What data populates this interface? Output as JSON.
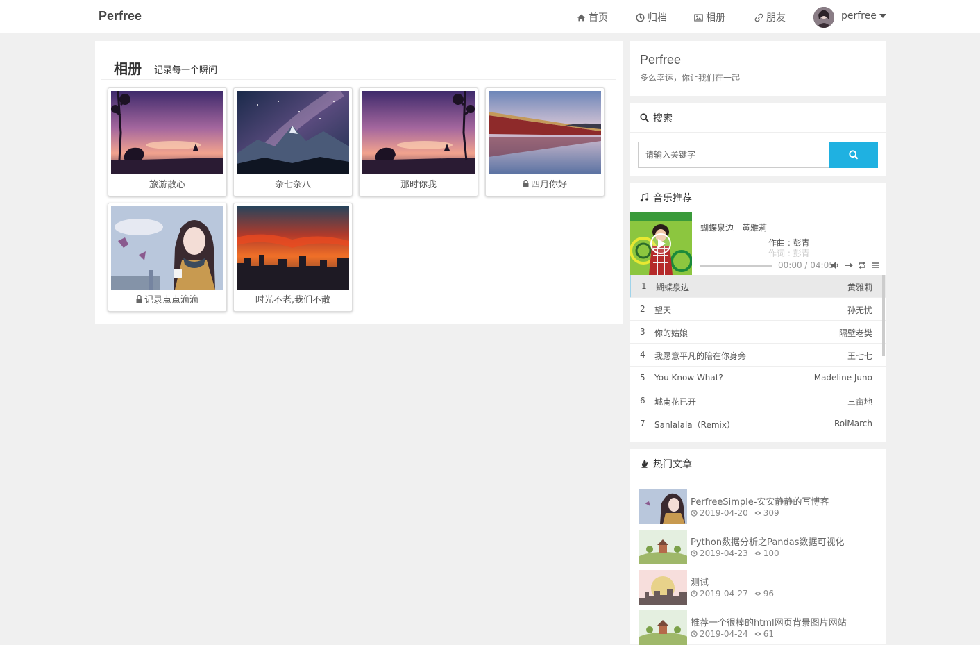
{
  "nav": {
    "brand": "Perfree",
    "items": [
      {
        "label": "首页",
        "icon": "home-icon"
      },
      {
        "label": "归档",
        "icon": "clock-icon"
      },
      {
        "label": "相册",
        "icon": "image-icon"
      },
      {
        "label": "朋友",
        "icon": "link-icon"
      }
    ],
    "user": "perfree"
  },
  "album": {
    "title": "相册",
    "subtitle": "记录每一个瞬间",
    "cards": [
      {
        "label": "旅游散心",
        "locked": false
      },
      {
        "label": "杂七杂八",
        "locked": false
      },
      {
        "label": "那时你我",
        "locked": false
      },
      {
        "label": "四月你好",
        "locked": true
      },
      {
        "label": "记录点点滴滴",
        "locked": true
      },
      {
        "label": "时光不老,我们不散",
        "locked": false
      }
    ]
  },
  "sidebar": {
    "site": {
      "title": "Perfree",
      "subtitle": "多么幸运，你让我们在一起"
    },
    "search": {
      "heading": "搜索",
      "placeholder": "请输入关键字"
    },
    "music": {
      "heading": "音乐推荐",
      "now_playing": "蝴蝶泉边 - 黄雅莉",
      "lyric_line1": "作曲 : 彭青",
      "lyric_line2": "作词 : 彭青",
      "time": "00:00 / 04:05",
      "progress": 0,
      "playlist": [
        {
          "n": "1",
          "title": "蝴蝶泉边",
          "artist": "黄雅莉"
        },
        {
          "n": "2",
          "title": "望天",
          "artist": "孙无忧"
        },
        {
          "n": "3",
          "title": "你的姑娘",
          "artist": "隔壁老樊"
        },
        {
          "n": "4",
          "title": "我愿意平凡的陪在你身旁",
          "artist": "王七七"
        },
        {
          "n": "5",
          "title": "You Know What?",
          "artist": "Madeline Juno"
        },
        {
          "n": "6",
          "title": "城南花已开",
          "artist": "三亩地"
        },
        {
          "n": "7",
          "title": "Sanlalala（Remix）",
          "artist": "RoiMarch"
        }
      ]
    },
    "hot": {
      "heading": "热门文章",
      "posts": [
        {
          "title": "PerfreeSimple-安安静静的写博客",
          "date": "2019-04-20",
          "views": "309"
        },
        {
          "title": "Python数据分析之Pandas数据可视化",
          "date": "2019-04-23",
          "views": "100"
        },
        {
          "title": "测试",
          "date": "2019-04-27",
          "views": "96"
        },
        {
          "title": "推荐一个很棒的html网页背景图片网站",
          "date": "2019-04-24",
          "views": "61"
        }
      ]
    }
  },
  "colors": {
    "accent": "#1fb1e1",
    "background": "#f0f0f0"
  }
}
